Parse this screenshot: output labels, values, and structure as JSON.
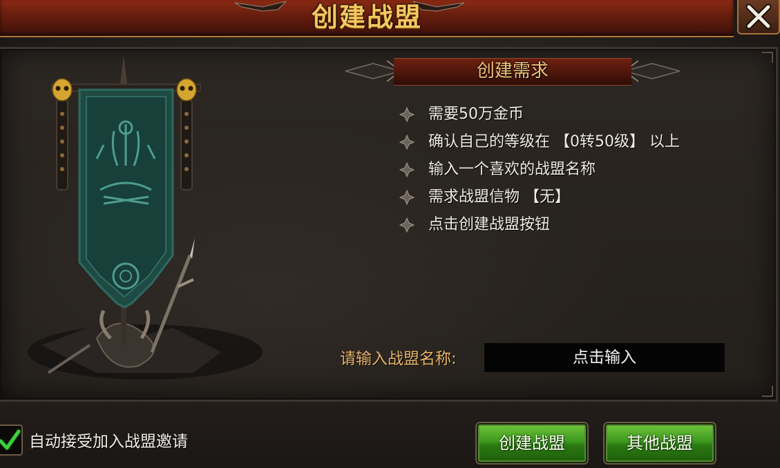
{
  "title": "创建战盟",
  "requirements": {
    "header": "创建需求",
    "items": [
      "需要50万金币",
      "确认自己的等级在 【0转50级】 以上",
      "输入一个喜欢的战盟名称",
      "需求战盟信物 【无】",
      "点击创建战盟按钮"
    ]
  },
  "name_input": {
    "label": "请输入战盟名称:",
    "placeholder": "点击输入"
  },
  "auto_accept": {
    "label": "自动接受加入战盟邀请",
    "checked": true
  },
  "buttons": {
    "create": "创建战盟",
    "other": "其他战盟"
  },
  "icons": {
    "close": "close-x-icon",
    "bullet": "diamond-bullet-icon",
    "check": "check-icon",
    "banner": "guild-banner-art"
  },
  "colors": {
    "title_text": "#f4c760",
    "header_text": "#f2c27a",
    "label_text": "#e7b468",
    "button_green": "#3d9a1e",
    "check_green": "#3fd03a"
  }
}
